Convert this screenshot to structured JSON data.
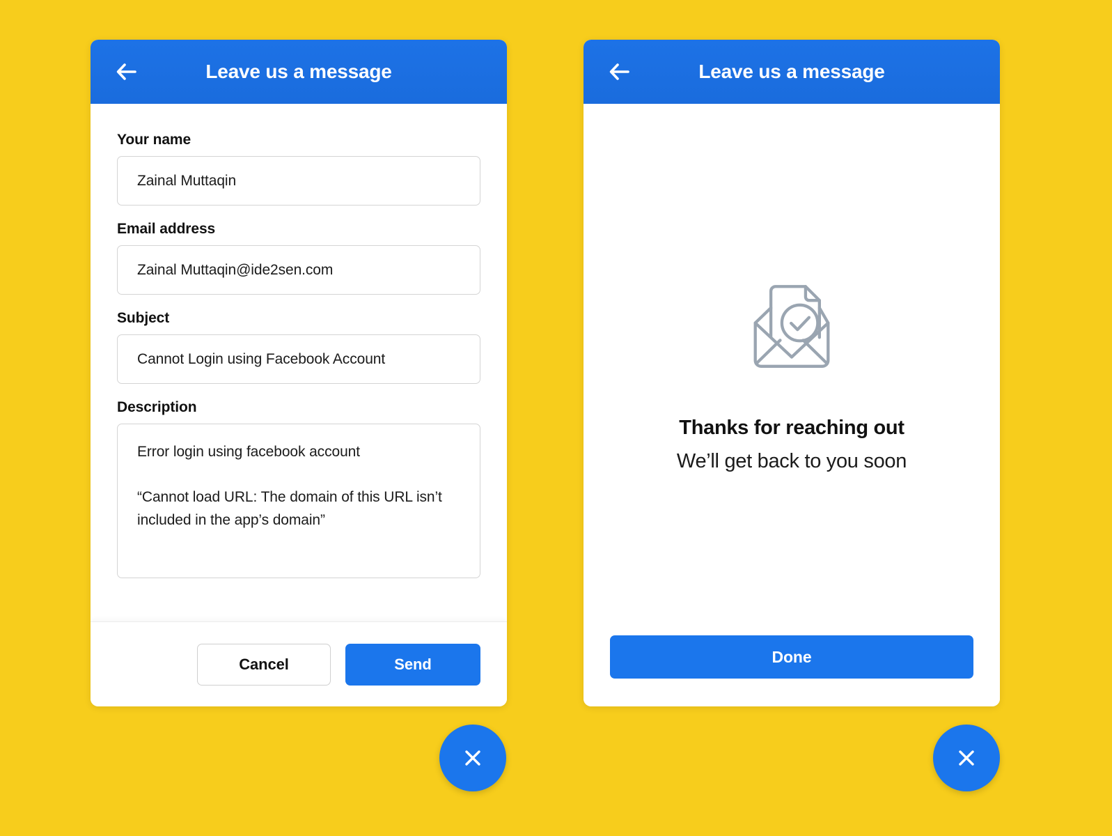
{
  "background_color": "#f7cd1c",
  "accent_color": "#1b76ec",
  "header_color": "#1b6ee0",
  "form_panel": {
    "header": {
      "title": "Leave us a message",
      "back_icon": "arrow-left-icon"
    },
    "fields": [
      {
        "label": "Your name",
        "value": "Zainal Muttaqin",
        "placeholder": "Your name"
      },
      {
        "label": "Email address",
        "value": "Zainal Muttaqin@ide2sen.com",
        "placeholder": "Email address"
      },
      {
        "label": "Subject",
        "value": "Cannot Login using Facebook Account",
        "placeholder": "Subject"
      }
    ],
    "description": {
      "label": "Description",
      "value": "Error login using facebook account\n\n“Cannot load URL: The domain of this URL isn’t included in the app’s domain”",
      "placeholder": "Description"
    },
    "footer": {
      "cancel_label": "Cancel",
      "send_label": "Send"
    }
  },
  "success_panel": {
    "header": {
      "title": "Leave us a message",
      "back_icon": "arrow-left-icon"
    },
    "illustration_icon": "open-envelope-with-checked-document-icon",
    "title": "Thanks for reaching out",
    "subtitle": "We’ll get back to you soon",
    "done_label": "Done"
  },
  "close_buttons": {
    "icon": "close-icon",
    "count": 2
  }
}
